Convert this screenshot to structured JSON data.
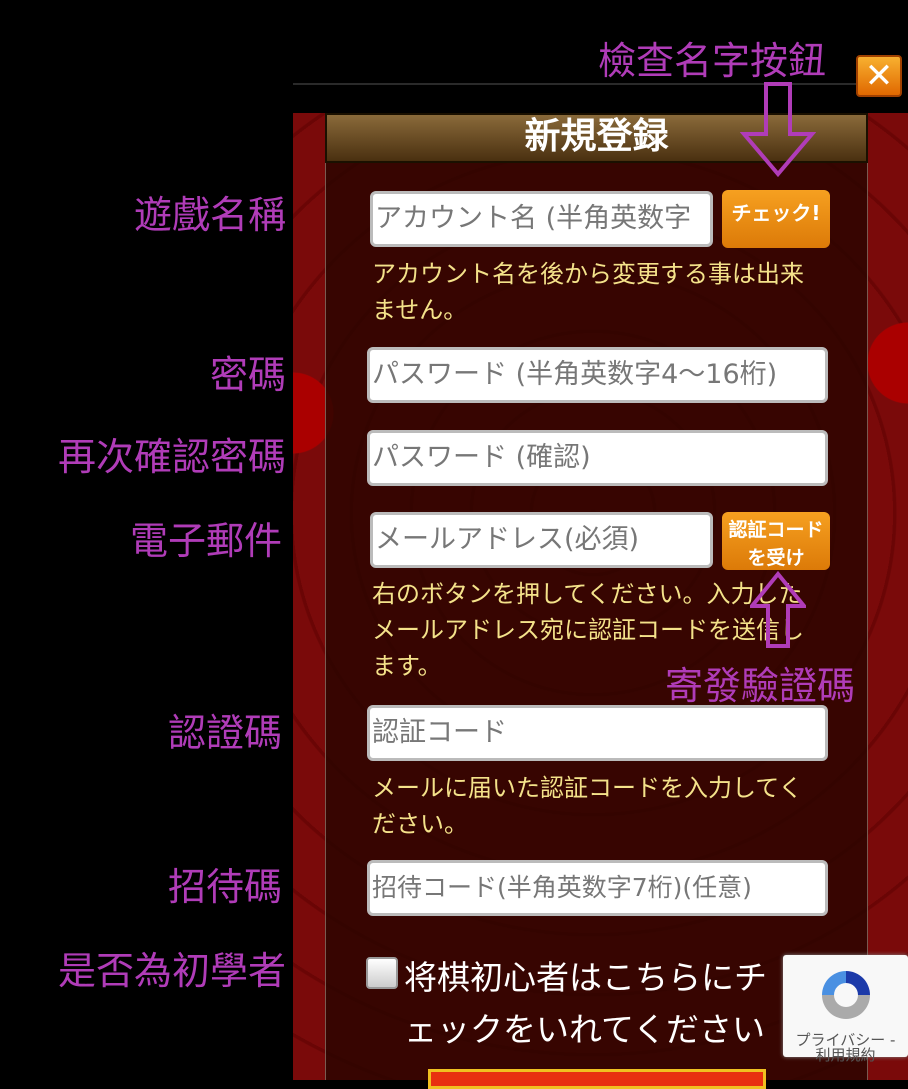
{
  "annotations": {
    "check_name_button": "檢查名字按鈕",
    "send_code": "寄發驗證碼",
    "labels": [
      "遊戲名稱",
      "密碼",
      "再次確認密碼",
      "電子郵件",
      "認證碼",
      "招待碼",
      "是否為初學者"
    ]
  },
  "dialog": {
    "title": "新規登録",
    "close_icon": "close-icon",
    "account_placeholder": "アカウント名 (半角英数字",
    "check_button": "チェック!",
    "account_note": "アカウント名を後から変更する事は出来ません。",
    "password_placeholder": "パスワード (半角英数字4〜16桁)",
    "password_confirm_placeholder": "パスワード (確認)",
    "email_placeholder": "メールアドレス(必須)",
    "code_button": "認証コードを受け",
    "email_note": "右のボタンを押してください。入力したメールアドレス宛に認証コードを送信します。",
    "code_placeholder": "認証コード",
    "code_note": "メールに届いた認証コードを入力してください。",
    "invite_placeholder": "招待コード(半角英数字7桁)(任意)",
    "beginner_label": "将棋初心者はこちらにチェックをいれてください",
    "beginner_checked": false
  },
  "recaptcha": {
    "privacy": "プライバシー -",
    "terms": "利用規約"
  },
  "colors": {
    "annotation": "#b03cb8",
    "button": "#e88a10",
    "note": "#f4e28a"
  }
}
